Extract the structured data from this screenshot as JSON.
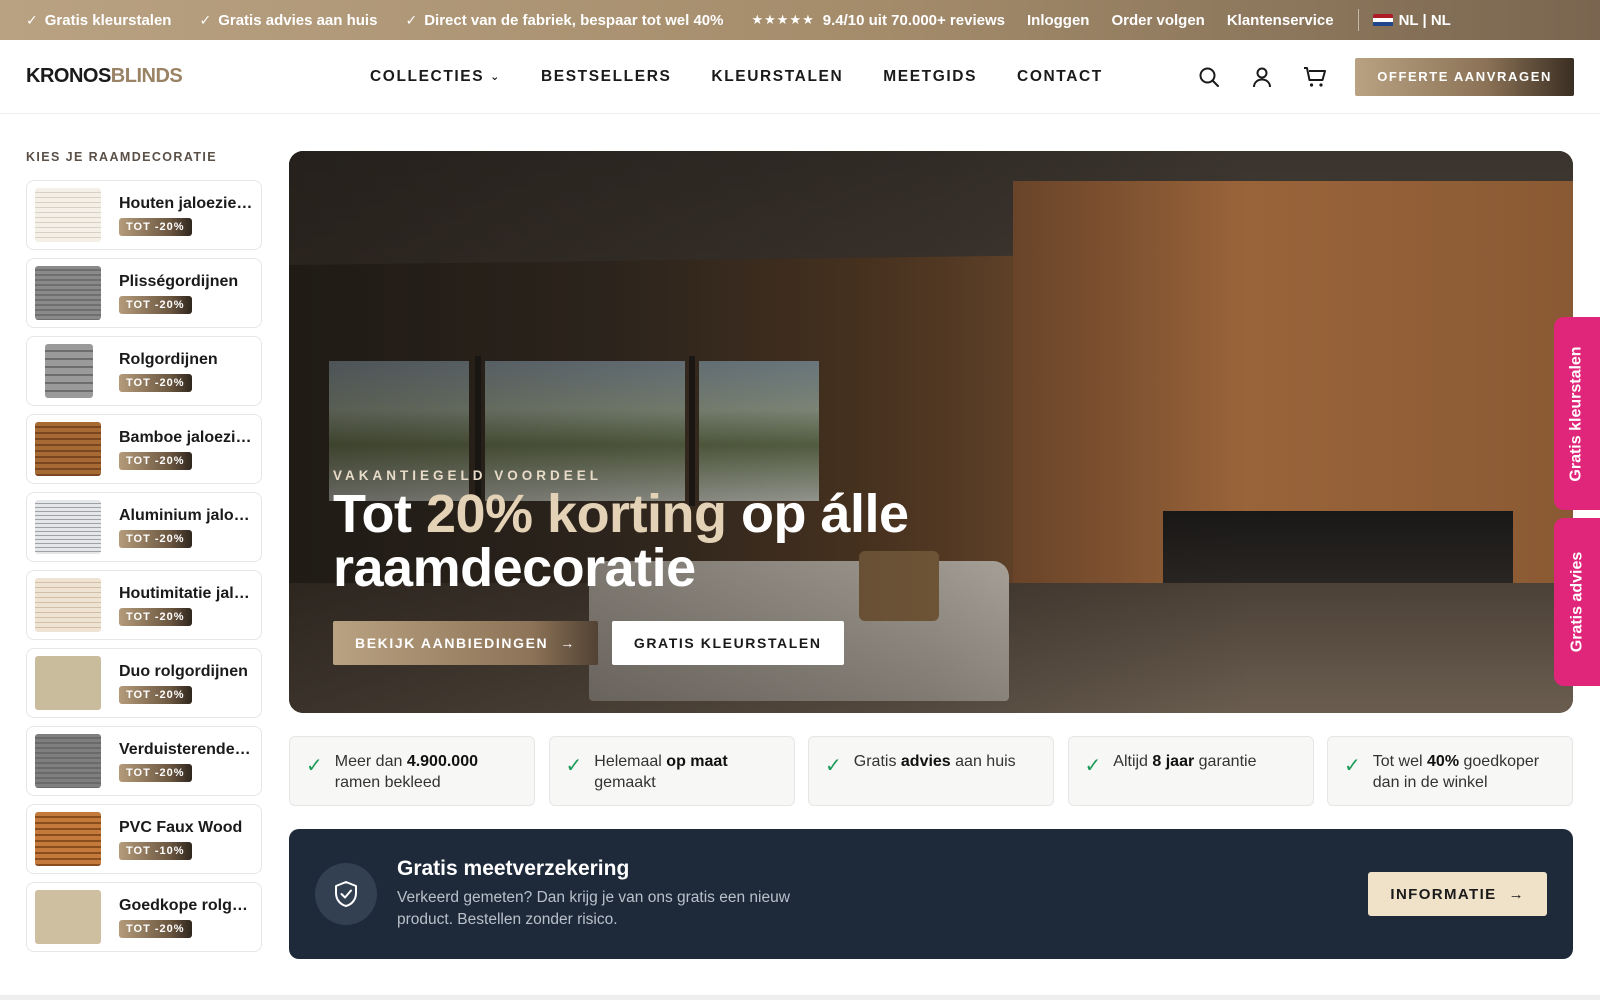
{
  "topbar": {
    "usps": [
      "Gratis kleurstalen",
      "Gratis advies aan huis",
      "Direct van de fabriek, bespaar tot wel 40%"
    ],
    "stars": "★★★★★",
    "rating": "9.4/10  uit 70.000+ reviews",
    "links": [
      "Inloggen",
      "Order volgen",
      "Klantenservice"
    ],
    "language": "NL | NL"
  },
  "header": {
    "logo_part1": "KRONOS",
    "logo_part2": "BLINDS",
    "nav": [
      "COLLECTIES",
      "BESTSELLERS",
      "KLEURSTALEN",
      "MEETGIDS",
      "CONTACT"
    ],
    "cta": "OFFERTE AANVRAGEN",
    "icons": [
      "search-icon",
      "user-icon",
      "cart-icon"
    ]
  },
  "sidebar": {
    "title": "KIES JE RAAMDECORATIE",
    "items": [
      {
        "label": "Houten jaloezieën",
        "badge": "TOT -20%"
      },
      {
        "label": "Plisségordijnen",
        "badge": "TOT -20%"
      },
      {
        "label": "Rolgordijnen",
        "badge": "TOT -20%"
      },
      {
        "label": "Bamboe jaloezieën",
        "badge": "TOT -20%"
      },
      {
        "label": "Aluminium jaloezieën",
        "badge": "TOT -20%"
      },
      {
        "label": "Houtimitatie jaloezieën",
        "badge": "TOT -20%"
      },
      {
        "label": "Duo rolgordijnen",
        "badge": "TOT -20%"
      },
      {
        "label": "Verduisterende rolgordijnen",
        "badge": "TOT -20%"
      },
      {
        "label": "PVC Faux Wood",
        "badge": "TOT -10%"
      },
      {
        "label": "Goedkope rolgordijnen",
        "badge": "TOT -20%"
      }
    ]
  },
  "hero": {
    "eyebrow": "VAKANTIEGELD VOORDEEL",
    "title_pre": "Tot ",
    "title_accent": "20% korting",
    "title_post": " op álle raamdecoratie",
    "btn_primary": "BEKIJK AANBIEDINGEN",
    "btn_secondary": "GRATIS KLEURSTALEN"
  },
  "side_tabs": [
    "Gratis kleurstalen",
    "Gratis advies"
  ],
  "usps": [
    {
      "pre": "Meer dan ",
      "bold": "4.900.000",
      "post": " ramen bekleed"
    },
    {
      "pre": "Helemaal ",
      "bold": "op maat",
      "post": " gemaakt"
    },
    {
      "pre": "Gratis ",
      "bold": "advies",
      "post": " aan huis"
    },
    {
      "pre": "Altijd ",
      "bold": "8 jaar",
      "post": " garantie"
    },
    {
      "pre": "Tot wel ",
      "bold": "40%",
      "post": " goedkoper dan in de winkel"
    }
  ],
  "measure": {
    "title": "Gratis meetverzekering",
    "description": "Verkeerd gemeten? Dan krijg je van ons gratis een nieuw product. Bestellen zonder risico.",
    "button": "INFORMATIE"
  },
  "colors": {
    "brand_gold": "#b9a282",
    "dark_navy": "#1e2a3a",
    "side_tab_pink": "#e0267a",
    "check_green": "#1d9b5a"
  }
}
